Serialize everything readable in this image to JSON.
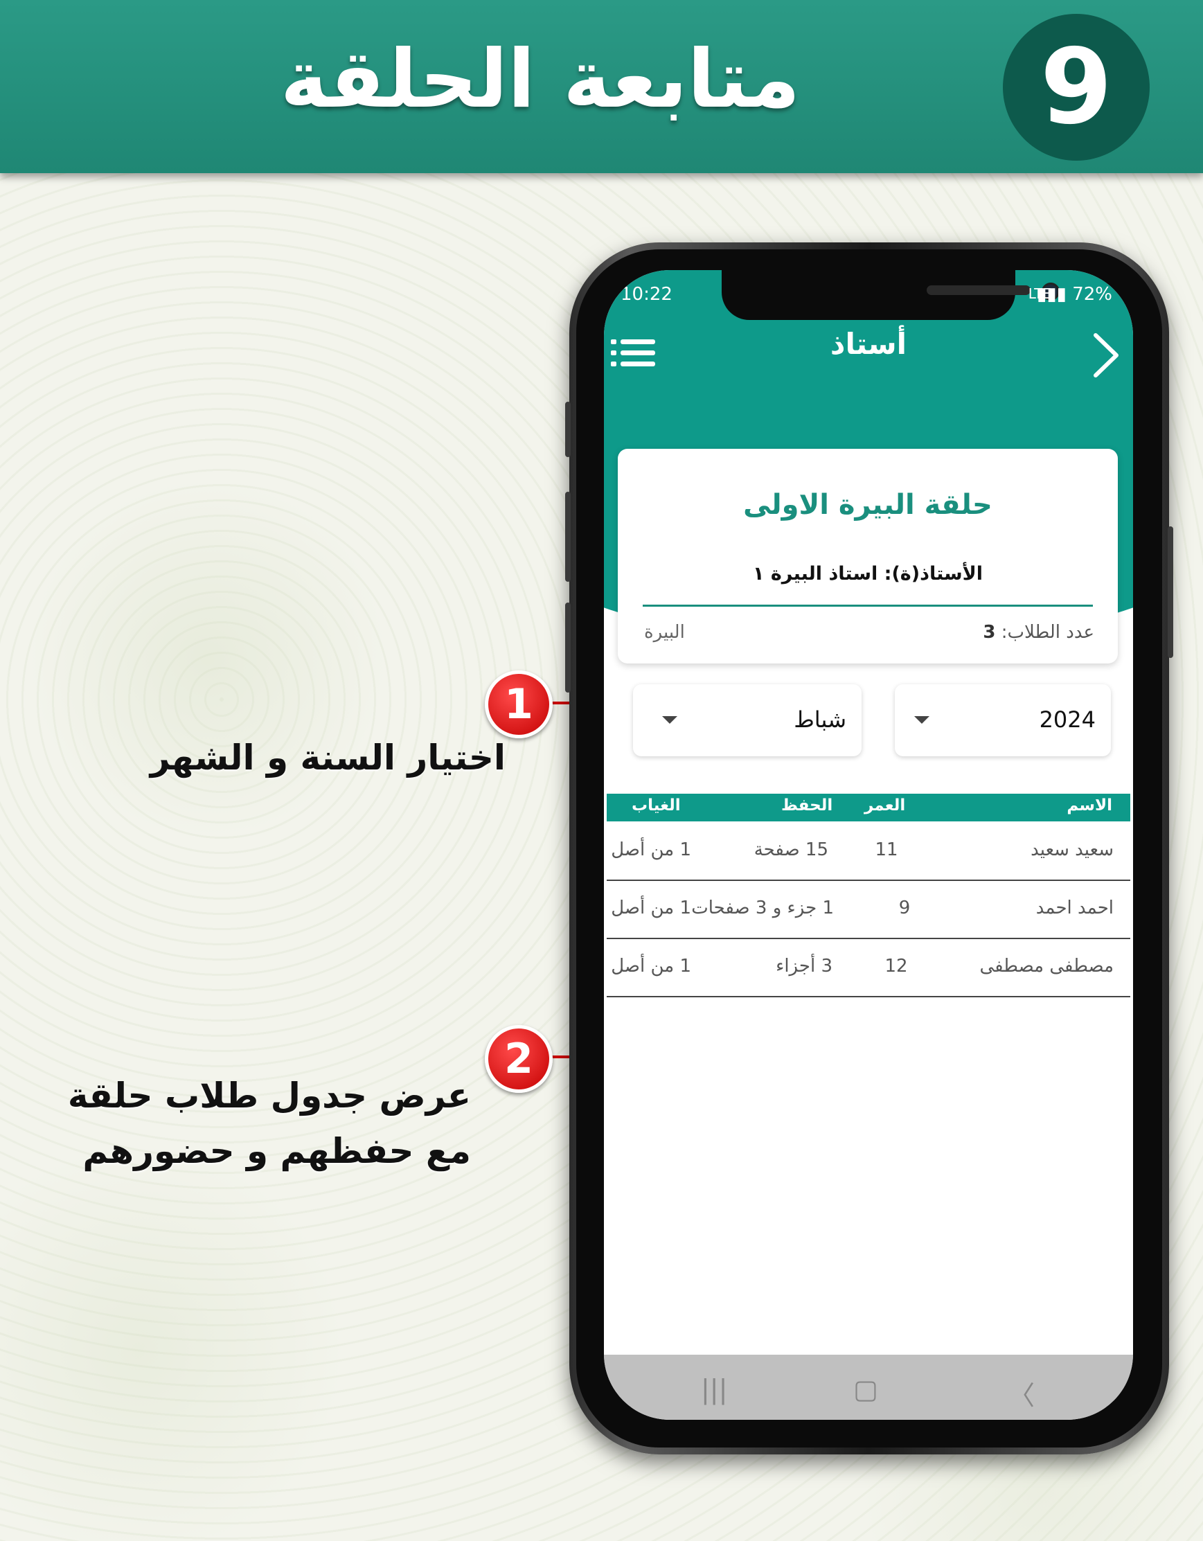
{
  "banner": {
    "title": "متابعة الحلقة",
    "number": "9"
  },
  "annotations": [
    {
      "number": "1",
      "text": "اختيار السنة و الشهر"
    },
    {
      "number": "2",
      "line1": "عرض جدول طلاب حلقة",
      "line2": "مع حفظهم و حضورهم"
    }
  ],
  "status_bar": {
    "time": "10:22",
    "network": "LTE",
    "battery": "72%"
  },
  "app": {
    "title": "أستاذ",
    "menu_icon": "menu-icon",
    "back_icon": "chevron-right-icon"
  },
  "card": {
    "title": "حلقة البيرة الاولى",
    "teacher_label": "الأستاذ(ة):",
    "teacher_value": "استاذ البيرة ١",
    "students_label": "عدد الطلاب:",
    "students_count": "3",
    "place": "البيرة"
  },
  "filters": {
    "year": "2024",
    "month": "شباط"
  },
  "table": {
    "headers": {
      "name": "الاسم",
      "age": "العمر",
      "memorization": "الحفظ",
      "absence": "الغياب"
    },
    "rows": [
      {
        "name": "سعيد سعيد",
        "age": "11",
        "memorization": "15 صفحة",
        "absence": "1 من أصل"
      },
      {
        "name": "احمد احمد",
        "age": "9",
        "memorization": "1 جزء و 3 صفحات",
        "absence": "1 من أصل"
      },
      {
        "name": "مصطفى مصطفى",
        "age": "12",
        "memorization": "3 أجزاء",
        "absence": "1 من أصل"
      }
    ]
  },
  "navbar": {
    "recents": "|||",
    "home": "▢",
    "back": "〈"
  },
  "colors": {
    "teal": "#0e9a8a",
    "banner": "#2b9a86",
    "badge": "#d40000"
  }
}
